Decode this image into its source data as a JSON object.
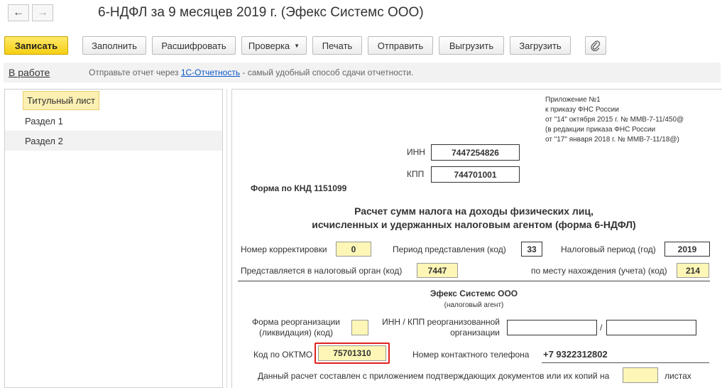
{
  "window": {
    "title": "6-НДФЛ за 9 месяцев 2019 г. (Эфекс Системс ООО)"
  },
  "toolbar": {
    "save": "Записать",
    "fill": "Заполнить",
    "decode": "Расшифровать",
    "check": "Проверка",
    "print": "Печать",
    "send": "Отправить",
    "export": "Выгрузить",
    "import": "Загрузить"
  },
  "infobar": {
    "status": "В работе",
    "message_before": "Отправьте отчет через ",
    "link": "1С-Отчетность",
    "message_after": " - самый удобный способ сдачи отчетности."
  },
  "sections": [
    {
      "label": "Титульный лист",
      "selected": true
    },
    {
      "label": "Раздел 1",
      "selected": false
    },
    {
      "label": "Раздел 2",
      "selected": false
    }
  ],
  "form": {
    "appendix": [
      "Приложение №1",
      "к приказу ФНС России",
      "от \"14\" октября 2015 г. № ММВ-7-11/450@",
      "(в редакции приказа ФНС России",
      "от \"17\" января 2018 г. № ММВ-7-11/18@)"
    ],
    "inn_label": "ИНН",
    "inn": "7447254826",
    "kpp_label": "КПП",
    "kpp": "744701001",
    "knd": "Форма по КНД 1151099",
    "heading_1": "Расчет сумм налога на доходы физических лиц,",
    "heading_2": "исчисленных и удержанных налоговым агентом (форма 6-НДФЛ)",
    "correction_label": "Номер корректировки",
    "correction": "0",
    "period_label": "Период представления (код)",
    "period": "33",
    "tax_period_label": "Налоговый период (год)",
    "tax_period": "2019",
    "tax_org_label": "Представляется в налоговый орган (код)",
    "tax_org": "7447",
    "location_label": "по месту нахождения (учета) (код)",
    "location": "214",
    "agent_name": "Эфекс Системс ООО",
    "agent_caption": "(налоговый агент)",
    "reorg_label_1": "Форма реорганизации",
    "reorg_label_2": "(ликвидация) (код)",
    "reorg": "",
    "reorg_inn_label_1": "ИНН / КПП реорганизованной",
    "reorg_inn_label_2": "организации",
    "reorg_inn": "",
    "reorg_sep": "/",
    "reorg_kpp": "",
    "oktmo_label": "Код по ОКТМО",
    "oktmo": "75701310",
    "phone_label": "Номер контактного телефона",
    "phone": "+7 9322312802",
    "pages_label": "Данный расчет составлен с приложением подтверждающих документов или их копий на",
    "pages": "",
    "pages_suffix": "листах"
  },
  "colors": {
    "primary_button": "#f6cf12",
    "selected_item": "#fcefb2",
    "input_fill": "#fdf6b6",
    "highlight_border": "#e02020",
    "link": "#0b57c9"
  }
}
